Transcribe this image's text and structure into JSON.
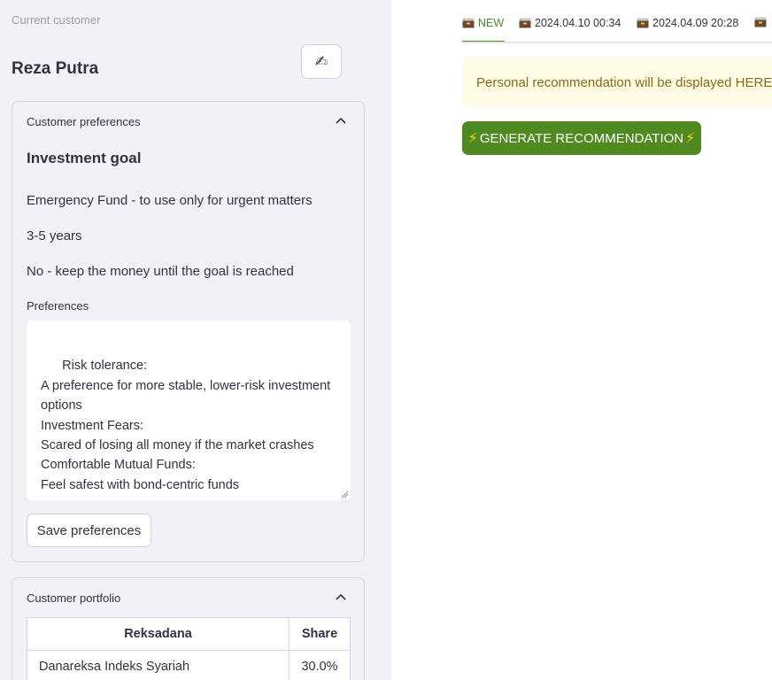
{
  "sidebar": {
    "current_customer_label": "Current customer",
    "customer_name": "Reza Putra",
    "edit_icon": "✍",
    "preferences_panel": {
      "title": "Customer preferences",
      "goal_heading": "Investment goal",
      "goal": "Emergency Fund - to use only for urgent matters",
      "horizon": "3-5 years",
      "withdrawal": "No - keep the money until the goal is reached",
      "preferences_label": "Preferences",
      "preferences_text": "Risk tolerance:\nA preference for more stable, lower-risk investment options\nInvestment Fears:\nScared of losing all money if the market crashes\nComfortable Mutual Funds:\nFeel safest with bond-centric funds",
      "save_button": "Save preferences"
    },
    "portfolio_panel": {
      "title": "Customer portfolio",
      "columns": [
        "Reksadana",
        "Share"
      ],
      "rows": [
        {
          "name": "Danareksa Indeks Syariah",
          "share": "30.0%"
        }
      ]
    }
  },
  "main": {
    "tabs": [
      {
        "label": "NEW",
        "icon": "card-box-icon",
        "active": true
      },
      {
        "label": "2024.04.10 00:34",
        "icon": "card-box-icon",
        "active": false
      },
      {
        "label": "2024.04.09 20:28",
        "icon": "card-box-icon",
        "active": false
      },
      {
        "label": "",
        "icon": "card-box-icon",
        "active": false
      }
    ],
    "recommendation_placeholder": "Personal recommendation will be displayed HERE",
    "generate_button": "GENERATE RECOMMENDATION"
  },
  "colors": {
    "sidebar_bg": "#f0f2f6",
    "accent_green": "#4f8a21",
    "info_bg": "#fffce6",
    "info_text": "#8c6a12"
  }
}
